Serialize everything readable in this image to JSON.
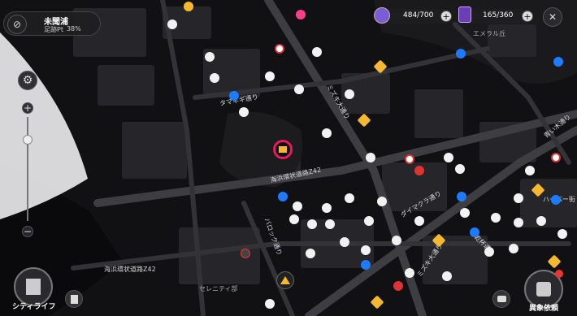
{
  "location": {
    "name": "未聞浦",
    "progress_label": "足跡Pt",
    "progress_value": "38%"
  },
  "resources": [
    {
      "name": "stamina",
      "value": "484/700",
      "icon": "stamina-icon"
    },
    {
      "name": "cards",
      "value": "165/360",
      "icon": "card-icon"
    }
  ],
  "buttons": {
    "close": "✕",
    "settings": "⚙",
    "zoom_in": "+",
    "zoom_out": "−",
    "city_life": "シティライフ",
    "anomaly": "異象依頼",
    "add": "+"
  },
  "map_labels": {
    "district_emerald": "エメラル丘",
    "serenity": "セレニティ部",
    "coastal_road_1": "海浜環状道路Z42",
    "coastal_road_2": "海浜環状道路Z42",
    "tamanegi_st": "タマネギ通り",
    "mizuki_st": "ミズキ大通り",
    "daimakura_st": "ダイマクラ通り",
    "baroque_st": "バロック通り",
    "harbor_st": "ハーバー街",
    "aoi_st": "青い木通り",
    "kanpai_st": "乾杯通り",
    "mizuki_st_2": "ミズキ大通り"
  },
  "colors": {
    "accent_gold": "#f5b82e",
    "marker_pink": "#e8185e",
    "poi_blue": "#1d7bff"
  }
}
